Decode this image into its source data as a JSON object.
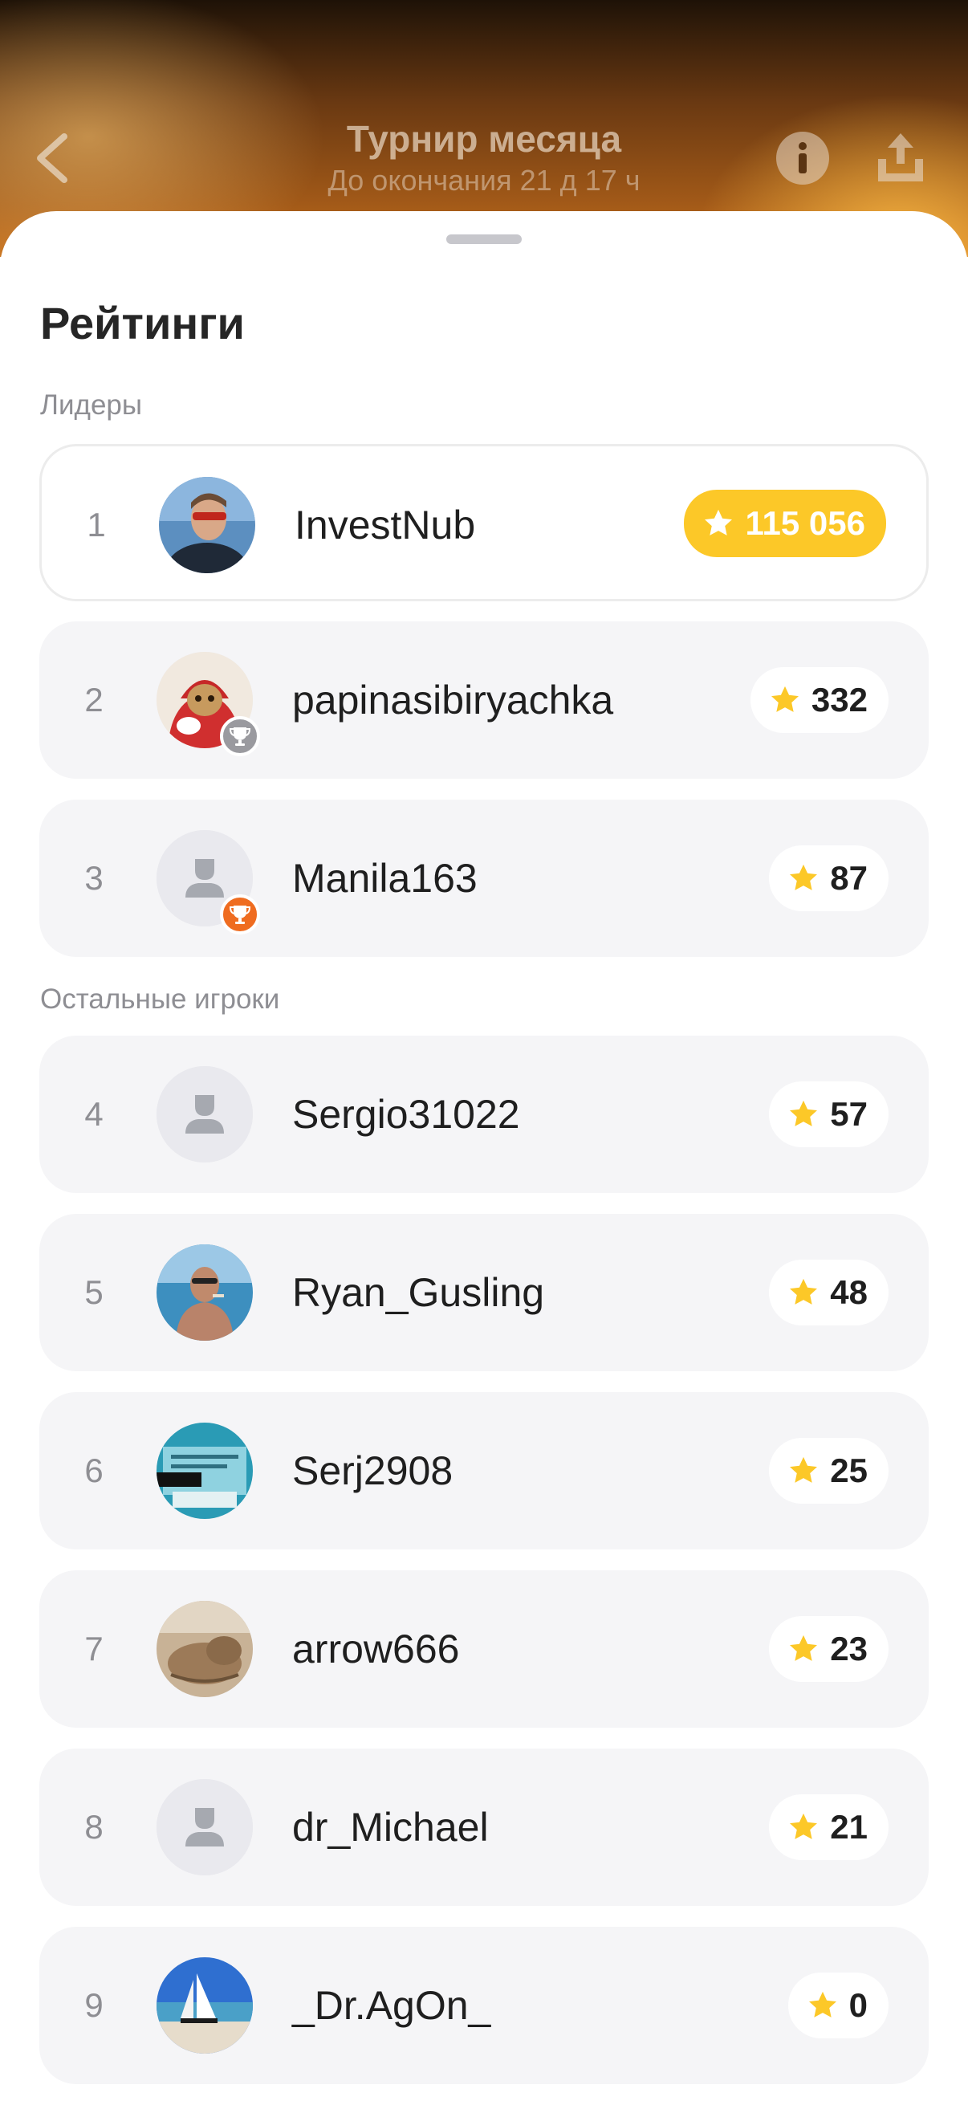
{
  "header": {
    "title": "Турнир месяца",
    "subtitle": "До окончания 21 д 17 ч",
    "icons": {
      "back": "chevron-left-icon",
      "info": "info-icon",
      "share": "share-icon"
    }
  },
  "sheet": {
    "title": "Рейтинги",
    "leaders_label": "Лидеры",
    "others_label": "Остальные игроки"
  },
  "colors": {
    "accent": "#fcc828",
    "silver_badge": "#9a9a9f",
    "bronze_badge": "#ef6c20",
    "row_background": "#f5f5f7",
    "rank_text": "#8e8e93"
  },
  "players": [
    {
      "rank": "1",
      "name": "InvestNub",
      "score": "115 056",
      "avatar": "photo-man-sunglasses",
      "badge": ""
    },
    {
      "rank": "2",
      "name": "papinasibiryachka",
      "score": "332",
      "avatar": "photo-cat-hoodie",
      "badge": "silver-trophy-icon"
    },
    {
      "rank": "3",
      "name": "Manila163",
      "score": "87",
      "avatar": "default-user-icon",
      "badge": "bronze-trophy-icon"
    },
    {
      "rank": "4",
      "name": "Sergio31022",
      "score": "57",
      "avatar": "default-user-icon",
      "badge": ""
    },
    {
      "rank": "5",
      "name": "Ryan_Gusling",
      "score": "48",
      "avatar": "photo-man-beach",
      "badge": ""
    },
    {
      "rank": "6",
      "name": "Serj2908",
      "score": "25",
      "avatar": "photo-document",
      "badge": ""
    },
    {
      "rank": "7",
      "name": "arrow666",
      "score": "23",
      "avatar": "photo-cat-sleeping",
      "badge": ""
    },
    {
      "rank": "8",
      "name": "dr_Michael",
      "score": "21",
      "avatar": "default-user-icon",
      "badge": ""
    },
    {
      "rank": "9",
      "name": "_Dr.AgOn_",
      "score": "0",
      "avatar": "photo-beach-sailboat",
      "badge": ""
    }
  ]
}
